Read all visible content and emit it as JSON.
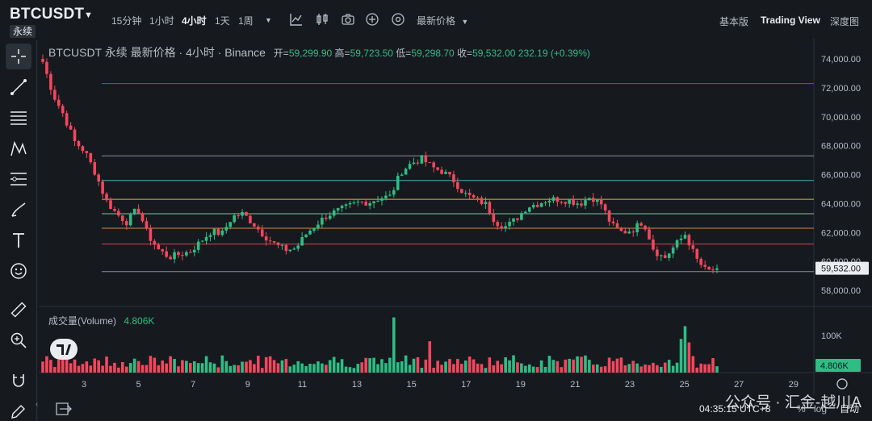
{
  "header": {
    "symbol": "BTCUSDT",
    "contract_badge": "永续",
    "timeframes": [
      "15分钟",
      "1小时",
      "4小时",
      "1天",
      "1周"
    ],
    "active_timeframe": "4小时",
    "price_mode": "最新价格",
    "view_tabs": [
      "基本版",
      "Trading View",
      "深度图"
    ],
    "active_view": "Trading View"
  },
  "legend": {
    "title": "BTCUSDT 永续 最新价格 · 4小时 · Binance",
    "open_label": "开=",
    "open": "59,299.90",
    "high_label": "高=",
    "high": "59,723.50",
    "low_label": "低=",
    "low": "59,298.70",
    "close_label": "收=",
    "close": "59,532.00",
    "change": "232.19 (+0.39%)"
  },
  "volume_legend": {
    "label": "成交量(Volume)",
    "value": "4.806K"
  },
  "footer": {
    "clock": "04:35:15 UTC+8",
    "percent": "%",
    "log": "log",
    "auto": "自动",
    "watermark": "公众号 · 汇金-越川A"
  },
  "colors": {
    "up": "#2ebd85",
    "down": "#f6465d",
    "bg": "#161a1e",
    "grid": "#22262c"
  },
  "chart_data": {
    "type": "candlestick",
    "title": "BTCUSDT 永续 最新价格 · 4小时 · Binance",
    "price_axis": {
      "ticks": [
        "74,000.00",
        "72,000.00",
        "70,000.00",
        "68,000.00",
        "66,000.00",
        "64,000.00",
        "62,000.00",
        "60,000.00",
        "58,000.00"
      ],
      "range": [
        57000,
        75400
      ],
      "last_price": "59,532.00"
    },
    "volume_axis": {
      "ticks": [
        "100K"
      ],
      "last_volume": "4.806K"
    },
    "x_ticks": [
      "3",
      "5",
      "7",
      "9",
      "11",
      "13",
      "15",
      "17",
      "19",
      "21",
      "23",
      "25",
      "27",
      "29"
    ],
    "horizontal_lines": [
      {
        "price": 72300,
        "color": "#3b5bdb"
      },
      {
        "price": 67300,
        "color": "#8a8f98"
      },
      {
        "price": 65600,
        "color": "#4dabc0"
      },
      {
        "price": 64300,
        "color": "#d4b84a"
      },
      {
        "price": 63300,
        "color": "#7fc4a0"
      },
      {
        "price": 62300,
        "color": "#d98a3a"
      },
      {
        "price": 61200,
        "color": "#d9434f"
      },
      {
        "price": 59300,
        "color": "#8a8f98"
      }
    ],
    "close_path": [
      73800,
      71500,
      70100,
      68300,
      67600,
      66100,
      64200,
      63300,
      62700,
      63700,
      61800,
      60800,
      60300,
      60500,
      60700,
      61400,
      62100,
      61900,
      63100,
      63300,
      62600,
      61800,
      61200,
      60800,
      60900,
      61900,
      62600,
      63200,
      63500,
      63800,
      64100,
      64100,
      64400,
      64500,
      66200,
      66800,
      67100,
      66500,
      66200,
      65600,
      64700,
      64300,
      64000,
      62700,
      62400,
      63000,
      63800,
      64000,
      64300,
      64300,
      64200,
      64000,
      64500,
      64000,
      62500,
      62000,
      62200,
      62800,
      60800,
      60200,
      61100,
      61900,
      60200,
      59300,
      59530
    ],
    "volume_spikes": {
      "88": 95,
      "97": 54,
      "160": 58,
      "161": 80,
      "162": 52
    }
  }
}
